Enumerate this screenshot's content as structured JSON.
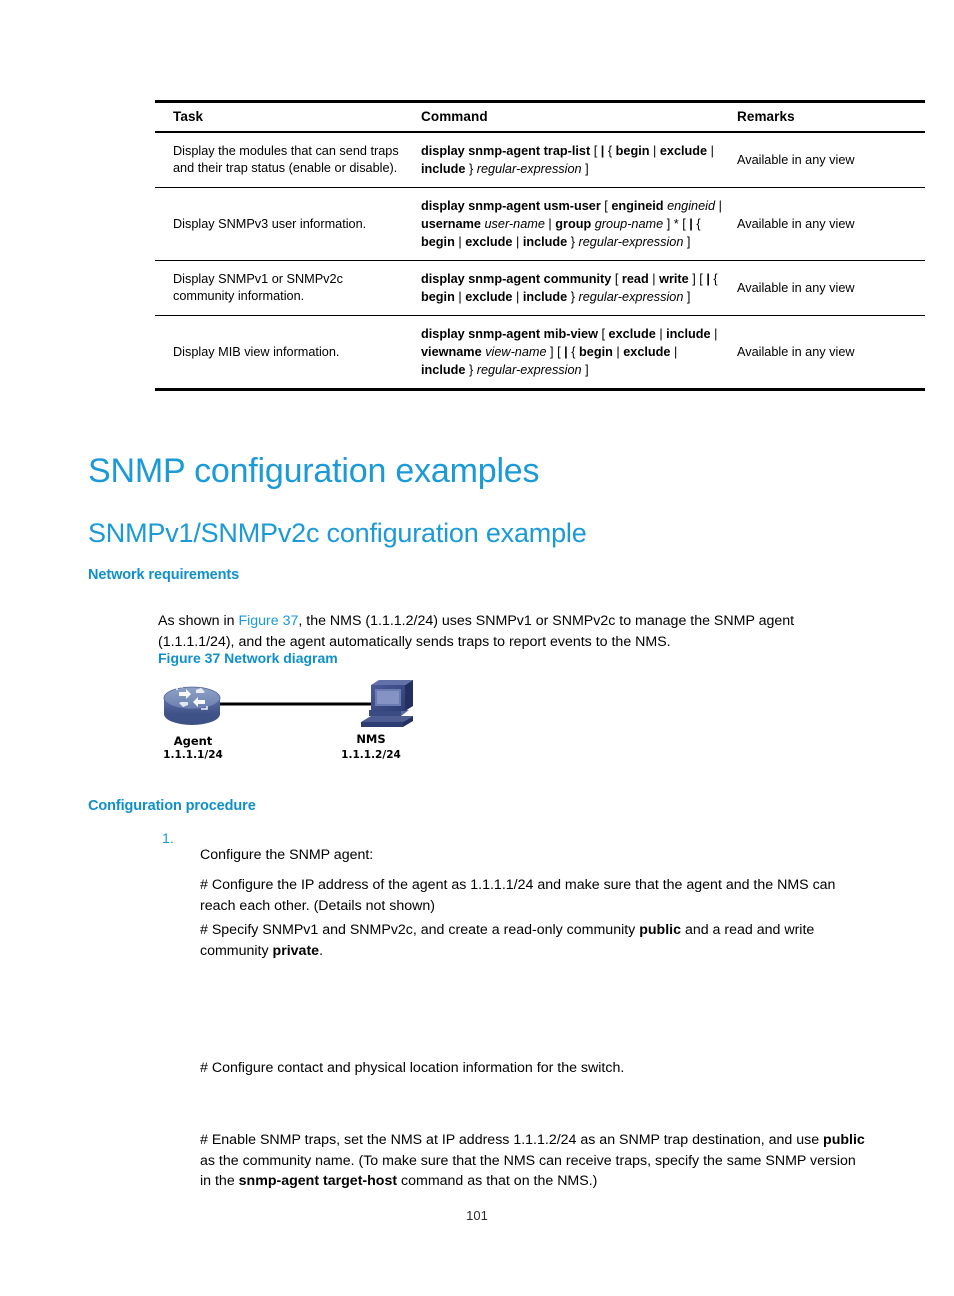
{
  "page": {
    "number": "101"
  },
  "table": {
    "headers": {
      "task": "Task",
      "command": "Command",
      "remarks": "Remarks"
    },
    "rows": [
      {
        "task": "Display the modules that can send traps and their trap status (enable or disable).",
        "command_html": "<b>display snmp-agent trap-list</b> [ <b>|</b> { <b>begin</b> | <b>exclude</b> | <b>include</b> } <i>regular-expression</i> ]",
        "command_text": "display snmp-agent trap-list [ | { begin | exclude | include } regular-expression ]",
        "remarks": "Available in any view"
      },
      {
        "task": "Display SNMPv3 user information.",
        "command_html": "<b>display snmp-agent usm-user</b> [ <b>engineid</b> <i>engineid</i> | <b>username</b> <i>user-name</i> | <b>group</b> <i>group-name</i> ] * [ <b>|</b> { <b>begin</b> | <b>exclude</b> | <b>include</b> } <i>regular-expression</i> ]",
        "command_text": "display snmp-agent usm-user [ engineid engineid | username user-name | group group-name ] * [ | { begin | exclude | include } regular-expression ]",
        "remarks": "Available in any view"
      },
      {
        "task": "Display SNMPv1 or SNMPv2c community information.",
        "command_html": "<b>display snmp-agent community</b> [ <b>read</b> | <b>write</b> ] [ <b>|</b> { <b>begin</b> | <b>exclude</b> | <b>include</b> } <i>regular-expression</i> ]",
        "command_text": "display snmp-agent community [ read | write ] [ | { begin | exclude | include } regular-expression ]",
        "remarks": "Available in any view"
      },
      {
        "task": "Display MIB view information.",
        "command_html": "<b>display snmp-agent mib-view</b> [ <b>exclude</b> | <b>include</b> | <b>viewname</b> <i>view-name</i> ] [ <b>|</b> { <b>begin</b> | <b>exclude</b> | <b>include</b> } <i>regular-expression</i> ]",
        "command_text": "display snmp-agent mib-view [ exclude | include | viewname view-name ] [ | { begin | exclude | include } regular-expression ]",
        "remarks": "Available in any view"
      }
    ]
  },
  "headings": {
    "h1": "SNMP configuration examples",
    "h2": "SNMPv1/SNMPv2c configuration example",
    "network_requirements": "Network requirements",
    "configuration_procedure": "Configuration procedure"
  },
  "body": {
    "intro_html": "As shown in <span class=\"link\">Figure 37</span>, the NMS (1.1.1.2/24) uses SNMPv1 or SNMPv2c to manage the SNMP agent (1.1.1.1/24), and the agent automatically sends traps to report events to the NMS.",
    "intro_text": "As shown in Figure 37, the NMS (1.1.1.2/24) uses SNMPv1 or SNMPv2c to manage the SNMP agent (1.1.1.1/24), and the agent automatically sends traps to report events to the NMS.",
    "figure_caption": "Figure 37 Network diagram",
    "step_number": "1.",
    "step1_text": "Configure the SNMP agent:",
    "hash1_text": "# Configure the IP address of the agent as 1.1.1.1/24 and make sure that the agent and the NMS can reach each other. (Details not shown)",
    "hash2_html": "# Specify SNMPv1 and SNMPv2c, and create a read-only community <b>public</b> and a read and write community <b>private</b>.",
    "hash2_text": "# Specify SNMPv1 and SNMPv2c, and create a read-only community public and a read and write community private.",
    "hash3_text": "# Configure contact and physical location information for the switch.",
    "hash4_html": "# Enable SNMP traps, set the NMS at IP address 1.1.1.2/24 as an SNMP trap destination, and use <b>public</b> as the community name. (To make sure that the NMS can receive traps, specify the same SNMP version in the <b>snmp-agent target-host</b> command as that on the NMS.)",
    "hash4_text": "# Enable SNMP traps, set the NMS at IP address 1.1.1.2/24 as an SNMP trap destination, and use public as the community name. (To make sure that the NMS can receive traps, specify the same SNMP version in the snmp-agent target-host command as that on the NMS.)"
  },
  "diagram": {
    "agent": {
      "label": "Agent",
      "ip": "1.1.1.1/24"
    },
    "nms": {
      "label": "NMS",
      "ip": "1.1.1.2/24"
    }
  },
  "colors": {
    "heading_blue": "#1b9ad7",
    "subheading_blue": "#0f8fcb",
    "link_blue": "#1b9ad7",
    "router_blue": "#5a6fa5",
    "nms_blue": "#3a4a82"
  }
}
